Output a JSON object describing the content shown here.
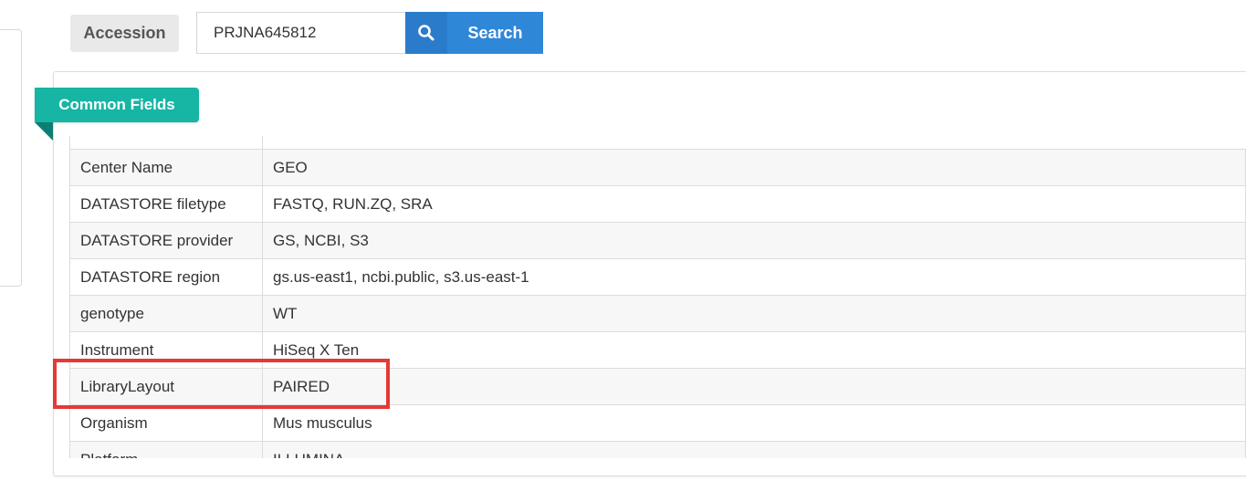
{
  "search": {
    "field_label": "Accession",
    "query_value": "PRJNA645812",
    "button_label": "Search",
    "button_icon": "search-icon"
  },
  "section": {
    "title": "Common Fields"
  },
  "fields": [
    {
      "key": "Center Name",
      "value": "GEO"
    },
    {
      "key": "DATASTORE filetype",
      "value": "FASTQ, RUN.ZQ, SRA"
    },
    {
      "key": "DATASTORE provider",
      "value": "GS, NCBI, S3"
    },
    {
      "key": "DATASTORE region",
      "value": "gs.us-east1, ncbi.public, s3.us-east-1"
    },
    {
      "key": "genotype",
      "value": "WT"
    },
    {
      "key": "Instrument",
      "value": "HiSeq X Ten"
    },
    {
      "key": "LibraryLayout",
      "value": "PAIRED"
    },
    {
      "key": "Organism",
      "value": "Mus musculus"
    },
    {
      "key": "Platform",
      "value": "ILLUMINA"
    }
  ],
  "highlight": {
    "row_key": "LibraryLayout",
    "color": "#e53935"
  },
  "colors": {
    "accent_blue": "#2f87d8",
    "ribbon_teal": "#16b5a4"
  }
}
